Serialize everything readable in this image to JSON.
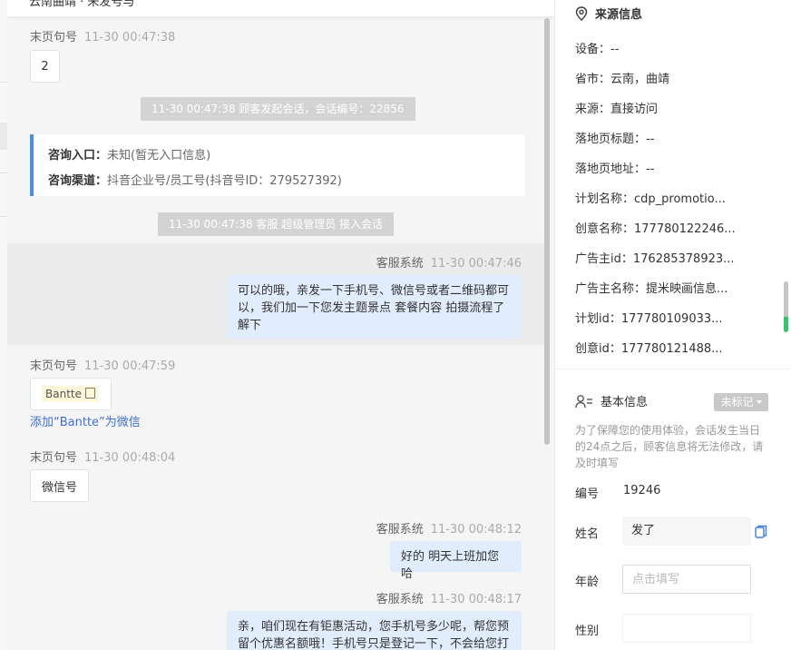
{
  "chat": {
    "header_text": "云南曲靖 · 未发号与",
    "messages": [
      {
        "sender": "末页句号",
        "time": "11-30 00:47:38",
        "content": "2"
      },
      {
        "sys_notice": "11-30 00:47:38 顾客发起会话，会话编号：22856"
      },
      {
        "entry": {
          "label": "咨询入口：",
          "value": "未知(暂无入口信息)"
        },
        "channel": {
          "label": "咨询渠道：",
          "value": "抖音企业号/员工号(抖音号ID：279527392)"
        }
      },
      {
        "sys_notice": "11-30 00:47:38 客服 超级管理员 接入会话"
      },
      {
        "sender": "客服系统",
        "time": "11-30 00:47:46",
        "content": [
          "可以的哦，亲发一下手机号、微信号或者二维码都可",
          "以，我们加一下您发主题景点 套餐内容 拍摄流程了",
          "解下"
        ]
      },
      {
        "sender": "末页句号",
        "time": "11-30 00:47:59",
        "content": "Bantte",
        "link": "添加“Bantte”为微信"
      },
      {
        "sender": "末页句号",
        "time": "11-30 00:48:04",
        "content": "微信号"
      },
      {
        "sender": "客服系统",
        "time": "11-30 00:48:12",
        "content": "好的 明天上班加您哈"
      },
      {
        "sender": "客服系统",
        "time": "11-30 00:48:17",
        "content": [
          "亲，咱们现在有钜惠活动，您手机号多少呢，帮您预",
          "留个优惠名额哦！手机号只是登记一下，不会给您打"
        ]
      }
    ]
  },
  "panel": {
    "source_title": "来源信息",
    "source_fields": [
      {
        "label": "设备：",
        "value": "--"
      },
      {
        "label": "省市：",
        "value": "云南，曲靖"
      },
      {
        "label": "来源：",
        "value": "直接访问"
      },
      {
        "label": "落地页标题：",
        "value": "--"
      },
      {
        "label": "落地页地址：",
        "value": "--"
      },
      {
        "label": "计划名称：",
        "value": "cdp_promotio..."
      },
      {
        "label": "创意名称：",
        "value": "177780122246..."
      },
      {
        "label": "广告主id：",
        "value": "176285378923..."
      },
      {
        "label": "广告主名称：",
        "value": "提米映画信息..."
      },
      {
        "label": "计划id：",
        "value": "177780109033..."
      },
      {
        "label": "创意id：",
        "value": "177780121488..."
      }
    ],
    "basic_title": "基本信息",
    "mark_label": "未标记",
    "notice": "为了保障您的使用体验，会话发生当日的24点之后，顾客信息将无法修改，请及时填写",
    "fields": {
      "id": {
        "label": "编号",
        "value": "19246"
      },
      "name": {
        "label": "姓名",
        "value": "发了"
      },
      "age": {
        "label": "年龄",
        "placeholder": "点击填写"
      },
      "gender": {
        "label": "性别"
      }
    }
  },
  "colors": {
    "accent": "#4a90e2",
    "bubble": "#e1ecfd",
    "link": "#3f6fd1",
    "scroll_green": "#39c36e"
  },
  "icons": [
    "location-pin-icon",
    "user-list-icon",
    "copy-icon",
    "caret-down-icon"
  ]
}
